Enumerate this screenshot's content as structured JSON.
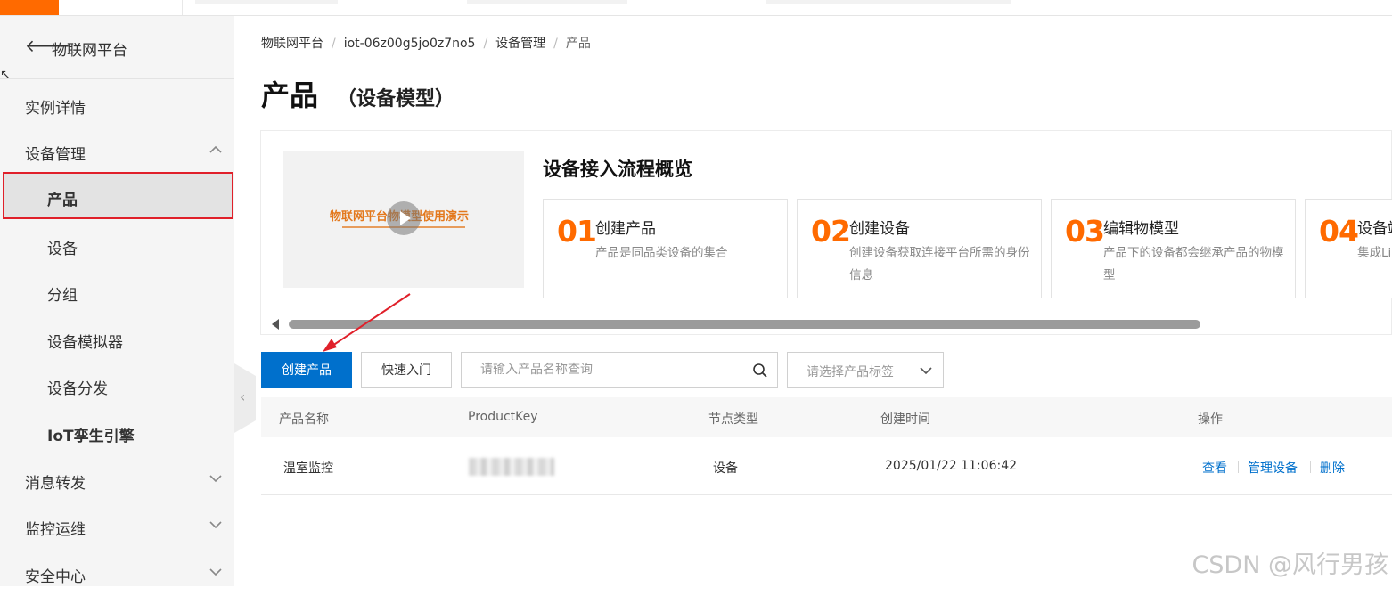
{
  "sidebar": {
    "back_label": "物联网平台",
    "items": [
      {
        "label": "实例详情"
      },
      {
        "label": "设备管理"
      },
      {
        "label": "产品"
      },
      {
        "label": "设备"
      },
      {
        "label": "分组"
      },
      {
        "label": "设备模拟器"
      },
      {
        "label": "设备分发"
      },
      {
        "label": "IoT孪生引擎"
      },
      {
        "label": "消息转发"
      },
      {
        "label": "监控运维"
      },
      {
        "label": "安全中心"
      }
    ]
  },
  "breadcrumb": [
    "物联网平台",
    "iot-06z00g5jo0z7no5",
    "设备管理",
    "产品"
  ],
  "page": {
    "title": "产品",
    "subtitle": "（设备模型）"
  },
  "guide": {
    "video_text": "物联网平台物模型使用演示",
    "title": "设备接入流程概览",
    "steps": [
      {
        "num": "01",
        "name": "创建产品",
        "desc": "产品是同品类设备的集合"
      },
      {
        "num": "02",
        "name": "创建设备",
        "desc": "创建设备获取连接平台所需的身份信息"
      },
      {
        "num": "03",
        "name": "编辑物模型",
        "desc": "产品下的设备都会继承产品的物模型"
      },
      {
        "num": "04",
        "name": "设备端开发",
        "desc": "集成Link SDK完成设备端程序"
      }
    ]
  },
  "toolbar": {
    "create_label": "创建产品",
    "quickstart_label": "快速入门",
    "search_placeholder": "请输入产品名称查询",
    "tag_placeholder": "请选择产品标签"
  },
  "table": {
    "headers": [
      "产品名称",
      "ProductKey",
      "节点类型",
      "创建时间",
      "操作"
    ],
    "rows": [
      {
        "name": "温室监控",
        "node_type": "设备",
        "created": "2025/01/22 11:06:42",
        "actions": [
          "查看",
          "管理设备",
          "删除"
        ]
      }
    ]
  },
  "watermark": "CSDN @风行男孩",
  "colors": {
    "brand": "#ff6a00",
    "primary": "#0070cc",
    "highlight": "#e0202a"
  }
}
